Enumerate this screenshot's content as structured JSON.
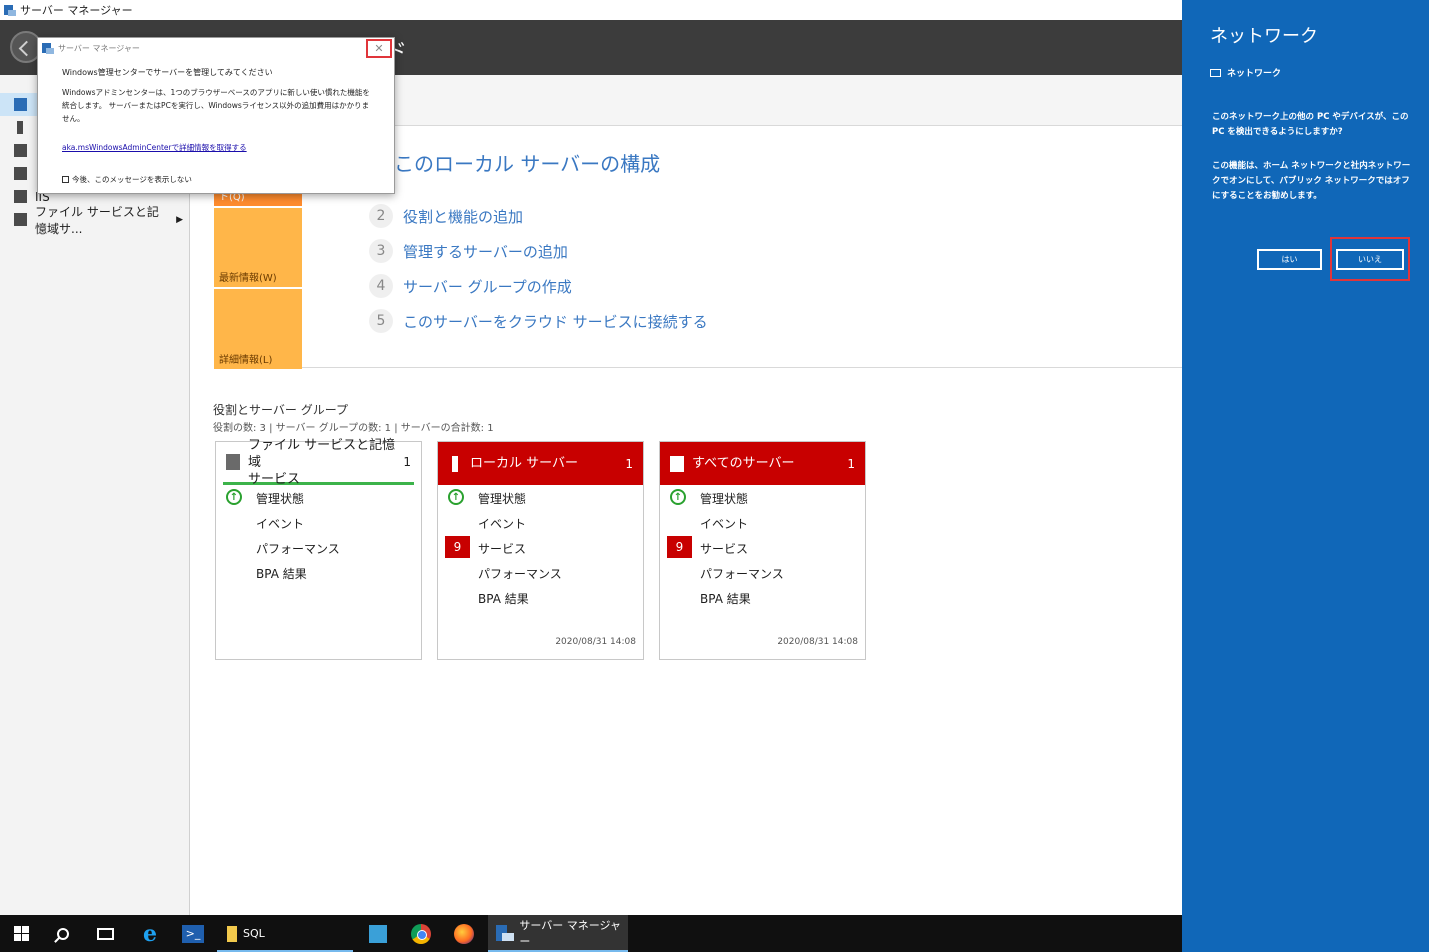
{
  "window": {
    "title": "サーバー マネージャー"
  },
  "header": {
    "title_fragment": "ド"
  },
  "sidebar": {
    "items": [
      {
        "label": ""
      },
      {
        "label": ""
      },
      {
        "label": ""
      },
      {
        "label": ""
      },
      {
        "label": "IIS"
      },
      {
        "label": "ファイル サービスと記憶域サ..."
      }
    ]
  },
  "welcome": {
    "quickstart_label": "クイック スタート(Q)",
    "news_label": "最新情報(W)",
    "more_label": "詳細情報(L)",
    "config_title": "このローカル サーバーの構成",
    "steps": [
      {
        "num": "2",
        "label": "役割と機能の追加"
      },
      {
        "num": "3",
        "label": "管理するサーバーの追加"
      },
      {
        "num": "4",
        "label": "サーバー グループの作成"
      },
      {
        "num": "5",
        "label": "このサーバーをクラウド サービスに接続する"
      }
    ]
  },
  "roles": {
    "title": "役割とサーバー グループ",
    "subtitle": "役割の数: 3   |   サーバー グループの数: 1   |   サーバーの合計数: 1"
  },
  "tiles": [
    {
      "name_line1": "ファイル サービスと記憶域",
      "name_line2": "サービス",
      "count": "1",
      "manageability": "管理状態",
      "events": "イベント",
      "performance": "パフォーマンス",
      "bpa": "BPA 結果"
    },
    {
      "name": "ローカル サーバー",
      "count": "1",
      "manageability": "管理状態",
      "events": "イベント",
      "services_badge": "9",
      "services": "サービス",
      "performance": "パフォーマンス",
      "bpa": "BPA 結果",
      "date": "2020/08/31 14:08"
    },
    {
      "name": "すべてのサーバー",
      "count": "1",
      "manageability": "管理状態",
      "events": "イベント",
      "services_badge": "9",
      "services": "サービス",
      "performance": "パフォーマンス",
      "bpa": "BPA 結果",
      "date": "2020/08/31 14:08"
    }
  ],
  "popup": {
    "title": "サーバー マネージャー",
    "close": "✕",
    "heading": "Windows管理センターでサーバーを管理してみてください",
    "body": "Windowsアドミンセンターは、1つのブラウザーベースのアプリに新しい使い慣れた機能を統合します。 サーバーまたはPCを実行し、Windowsライセンス以外の追加費用はかかりません。",
    "link": "aka.msWindowsAdminCenterで詳細情報を取得する",
    "checkbox": "今後、このメッセージを表示しない"
  },
  "network": {
    "title": "ネットワーク",
    "subtitle": "ネットワーク",
    "question": "このネットワーク上の他の PC やデバイスが、この PC を検出できるようにしますか?",
    "description": "この機能は、ホーム ネットワークと社内ネットワークでオンにして、パブリック ネットワークではオフにすることをお勧めします。",
    "yes": "はい",
    "no": "いいえ"
  },
  "taskbar": {
    "sql_label": "SQL",
    "server_manager_label": "サーバー マネージャー"
  }
}
